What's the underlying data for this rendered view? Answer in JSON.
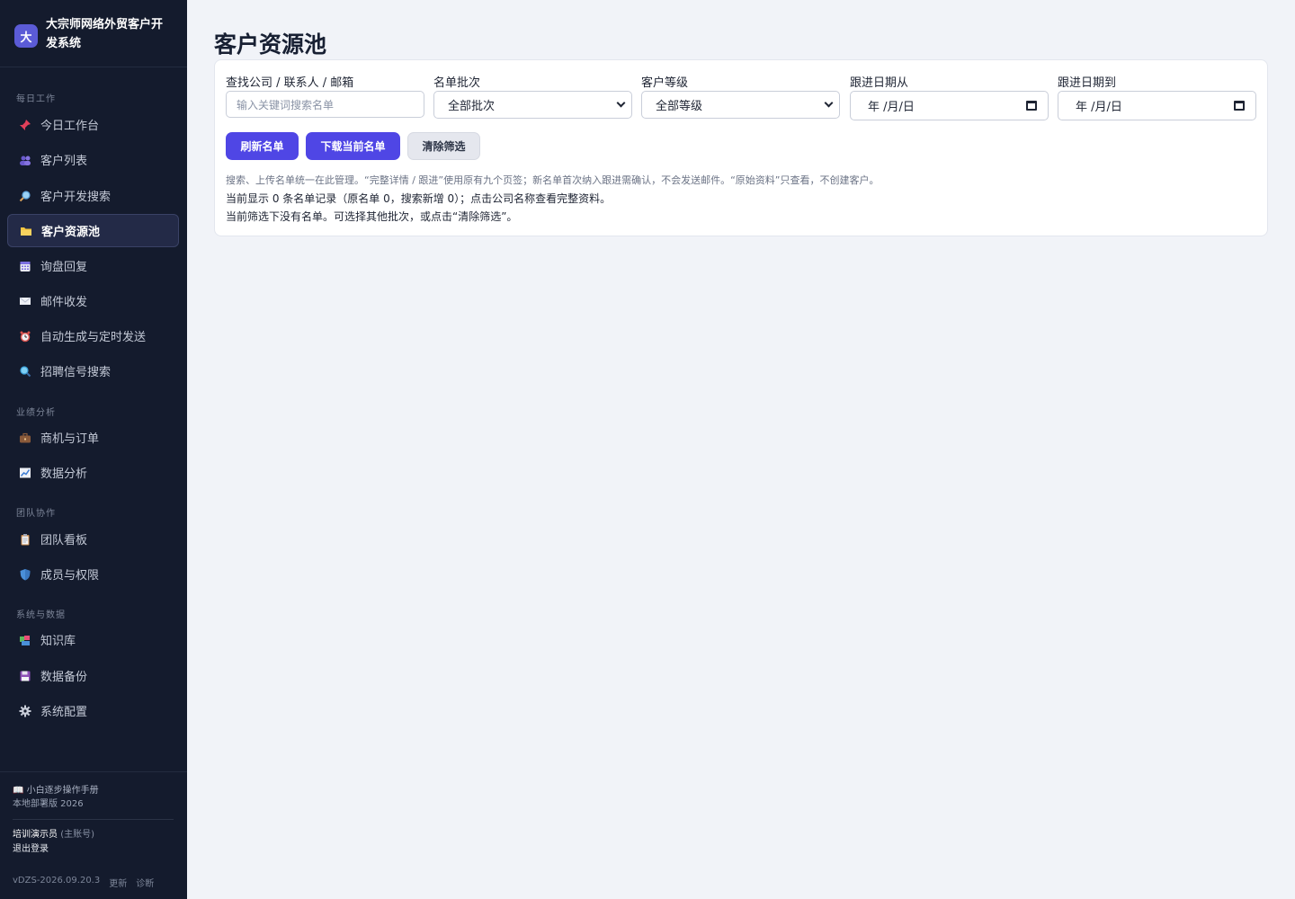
{
  "brand": {
    "logo": "大",
    "title": "大宗师网络外贸客户开发系统"
  },
  "nav": {
    "groups": [
      "每日工作",
      "业绩分析",
      "团队协作",
      "系统与数据"
    ],
    "items": [
      {
        "label": "今日工作台",
        "icon": "pin-icon"
      },
      {
        "label": "客户列表",
        "icon": "people-icon"
      },
      {
        "label": "客户开发搜索",
        "icon": "magnifier-icon"
      },
      {
        "label": "客户资源池",
        "icon": "folder-icon"
      },
      {
        "label": "询盘回复",
        "icon": "calendar-icon"
      },
      {
        "label": "邮件收发",
        "icon": "envelope-icon"
      },
      {
        "label": "自动生成与定时发送",
        "icon": "alarm-clock-icon"
      },
      {
        "label": "招聘信号搜索",
        "icon": "search-icon"
      },
      {
        "label": "商机与订单",
        "icon": "briefcase-icon"
      },
      {
        "label": "数据分析",
        "icon": "chart-icon"
      },
      {
        "label": "团队看板",
        "icon": "clipboard-icon"
      },
      {
        "label": "成员与权限",
        "icon": "shield-icon"
      },
      {
        "label": "知识库",
        "icon": "books-icon"
      },
      {
        "label": "数据备份",
        "icon": "floppy-icon"
      },
      {
        "label": "系统配置",
        "icon": "gear-icon"
      }
    ]
  },
  "footer": {
    "manual": "📖 小白逐步操作手册",
    "deploy": "本地部署版 2026",
    "user_name": "培训演示员",
    "user_role": "(主账号)",
    "logout": "退出登录",
    "version": "vDZS-2026.09.20.3",
    "update": "更新",
    "diagnose": "诊断"
  },
  "page": {
    "title": "客户资源池"
  },
  "filters": {
    "search_label": "查找公司 / 联系人 / 邮箱",
    "search_placeholder": "输入关键词搜索名单",
    "batch_label": "名单批次",
    "batch_value": "全部批次",
    "level_label": "客户等级",
    "level_value": "全部等级",
    "date_from_label": "跟进日期从",
    "date_to_label": "跟进日期到",
    "date_placeholder": "年 /月/日"
  },
  "buttons": {
    "refresh": "刷新名单",
    "download": "下载当前名单",
    "clear": "清除筛选"
  },
  "messages": {
    "hint": "搜索、上传名单统一在此管理。“完整详情 / 跟进”使用原有九个页签；新名单首次纳入跟进需确认，不会发送邮件。“原始资料”只查看，不创建客户。",
    "count": "当前显示 0 条名单记录（原名单 0，搜索新增 0）；点击公司名称查看完整资料。",
    "empty": "当前筛选下没有名单。可选择其他批次，或点击“清除筛选”。"
  },
  "colors": {
    "sidebar_bg": "#141b2d",
    "accent": "#4f46e5",
    "page_bg": "#f1f3f8"
  }
}
